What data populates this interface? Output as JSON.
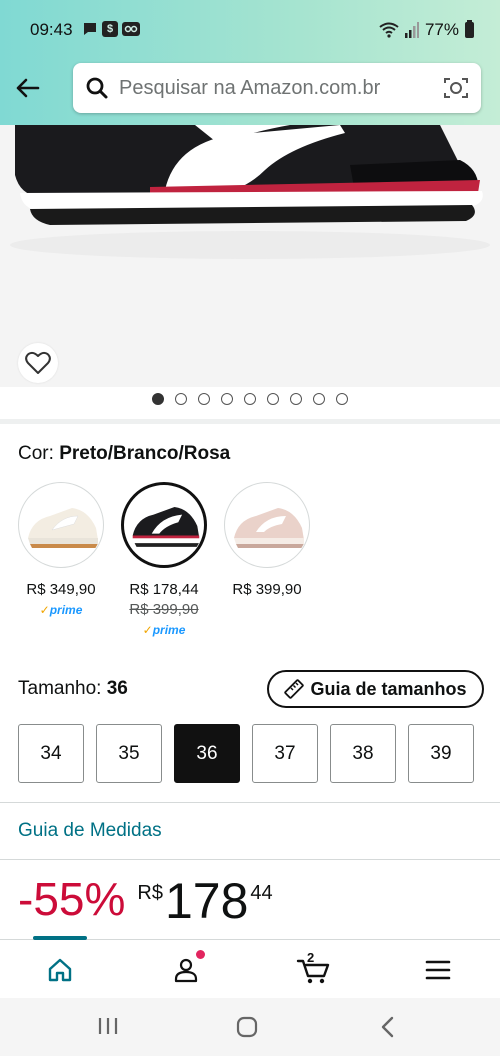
{
  "status_bar": {
    "time": "09:43",
    "left_icons": [
      "message-icon",
      "dollar-app-icon",
      "voicemail-icon"
    ],
    "battery": "77%",
    "right_icons": [
      "wifi-icon",
      "signal-icon",
      "battery-icon"
    ]
  },
  "header": {
    "search_placeholder": "Pesquisar na Amazon.com.br",
    "back_icon": "arrow-left-icon",
    "camera_icon": "camera-lens-icon"
  },
  "gallery": {
    "total_images": 9,
    "active_index": 0
  },
  "color": {
    "label": "Cor:",
    "selected": "Preto/Branco/Rosa",
    "options": [
      {
        "price": "R$ 349,90",
        "strike_price": "",
        "prime": true,
        "style": "white",
        "selected": false
      },
      {
        "price": "R$ 178,44",
        "strike_price": "R$ 399,90",
        "prime": true,
        "style": "black",
        "selected": true
      },
      {
        "price": "R$ 399,90",
        "strike_price": "",
        "prime": false,
        "style": "pink",
        "selected": false
      }
    ],
    "prime_text": "prime"
  },
  "size": {
    "label": "Tamanho:",
    "selected": "36",
    "guide_button": "Guia de tamanhos",
    "options": [
      "34",
      "35",
      "36",
      "37",
      "38",
      "39"
    ]
  },
  "measures_link": "Guia de Medidas",
  "price": {
    "discount": "-55%",
    "currency": "R$",
    "whole": "178",
    "fraction": "44"
  },
  "bottom_nav": {
    "cart_count": "2",
    "items": [
      "home-icon",
      "account-icon",
      "cart-icon",
      "menu-icon"
    ]
  },
  "colors": {
    "header_start": "#80d9d3",
    "header_end": "#c4edd6",
    "link": "#007185",
    "discount": "#cc0c39",
    "prime": "#1a98ff"
  }
}
